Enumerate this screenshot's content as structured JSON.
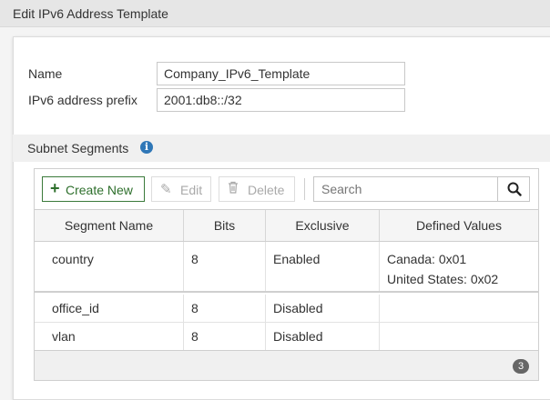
{
  "window": {
    "title": "Edit IPv6 Address Template"
  },
  "form": {
    "name_label": "Name",
    "name_value": "Company_IPv6_Template",
    "prefix_label": "IPv6 address prefix",
    "prefix_value": "2001:db8::/32"
  },
  "subnet": {
    "title": "Subnet Segments",
    "info_icon": "info-icon"
  },
  "toolbar": {
    "create_label": "Create New",
    "edit_label": "Edit",
    "delete_label": "Delete",
    "search_placeholder": "Search",
    "icons": {
      "create": "plus-icon",
      "edit": "pencil-icon",
      "delete": "trash-icon",
      "search": "search-icon"
    }
  },
  "table": {
    "columns": [
      "Segment Name",
      "Bits",
      "Exclusive",
      "Defined Values"
    ],
    "rows": [
      {
        "name": "country",
        "bits": "8",
        "exclusive": "Enabled",
        "values": [
          "Canada: 0x01",
          "United States: 0x02"
        ]
      },
      {
        "name": "office_id",
        "bits": "8",
        "exclusive": "Disabled",
        "values": []
      },
      {
        "name": "vlan",
        "bits": "8",
        "exclusive": "Disabled",
        "values": []
      }
    ],
    "count": "3"
  },
  "colors": {
    "accent_green": "#2e6f2c",
    "info_blue": "#2f77b7"
  }
}
